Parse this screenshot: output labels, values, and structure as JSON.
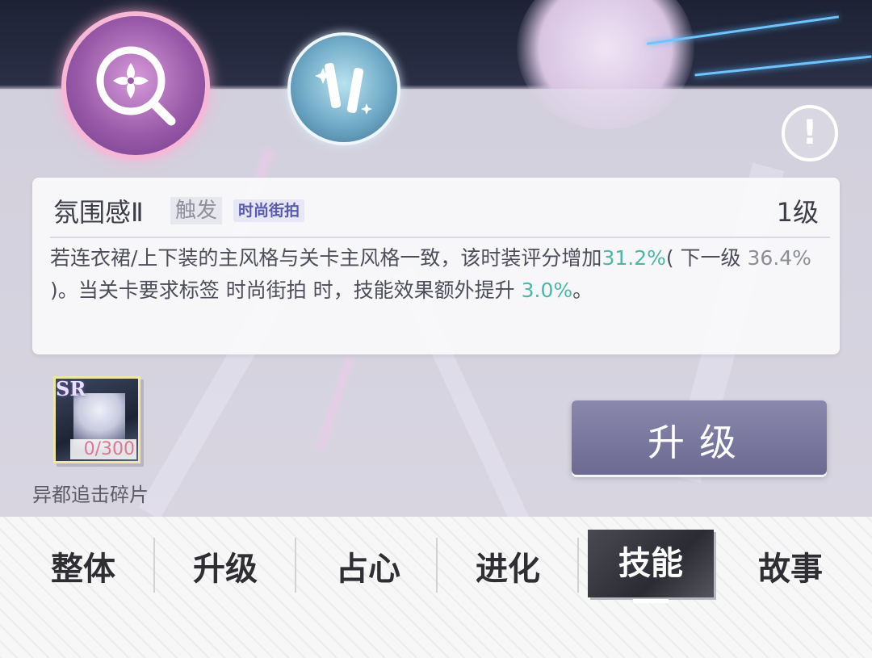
{
  "skill_icons": [
    {
      "name": "atmosphere-skill",
      "selected": true,
      "icon": "flower-magnifier-icon"
    },
    {
      "name": "second-skill",
      "selected": false,
      "icon": "batons-icon"
    }
  ],
  "info_icon": "!",
  "skill": {
    "name": "氛围感Ⅱ",
    "trigger": "触发",
    "style_tag": "时尚街拍",
    "level": "1级",
    "desc_part1": "若连衣裙/上下装的主风格与关卡主风格一致，该时装评分增加",
    "bonus": "31.2%",
    "next_open": "( 下一级 ",
    "next_value": "36.4%",
    "next_close": " )",
    "desc_part2": "。当关卡要求标签 时尚街拍 时，技能效果额外提升 ",
    "extra": "3.0%",
    "desc_end": "。"
  },
  "shard": {
    "rarity": "SR",
    "count": "0/300",
    "name": "异都追击碎片"
  },
  "upgrade_button": "升级",
  "tabs": [
    {
      "label": "整体",
      "active": false
    },
    {
      "label": "升级",
      "active": false
    },
    {
      "label": "占心",
      "active": false
    },
    {
      "label": "进化",
      "active": false
    },
    {
      "label": "技能",
      "active": true
    },
    {
      "label": "故事",
      "active": false
    }
  ],
  "colors": {
    "accent_green": "#4fb5a5",
    "upgrade_button": "#7a789f",
    "active_tab": "#2b2b33",
    "shard_count": "#d97891"
  }
}
